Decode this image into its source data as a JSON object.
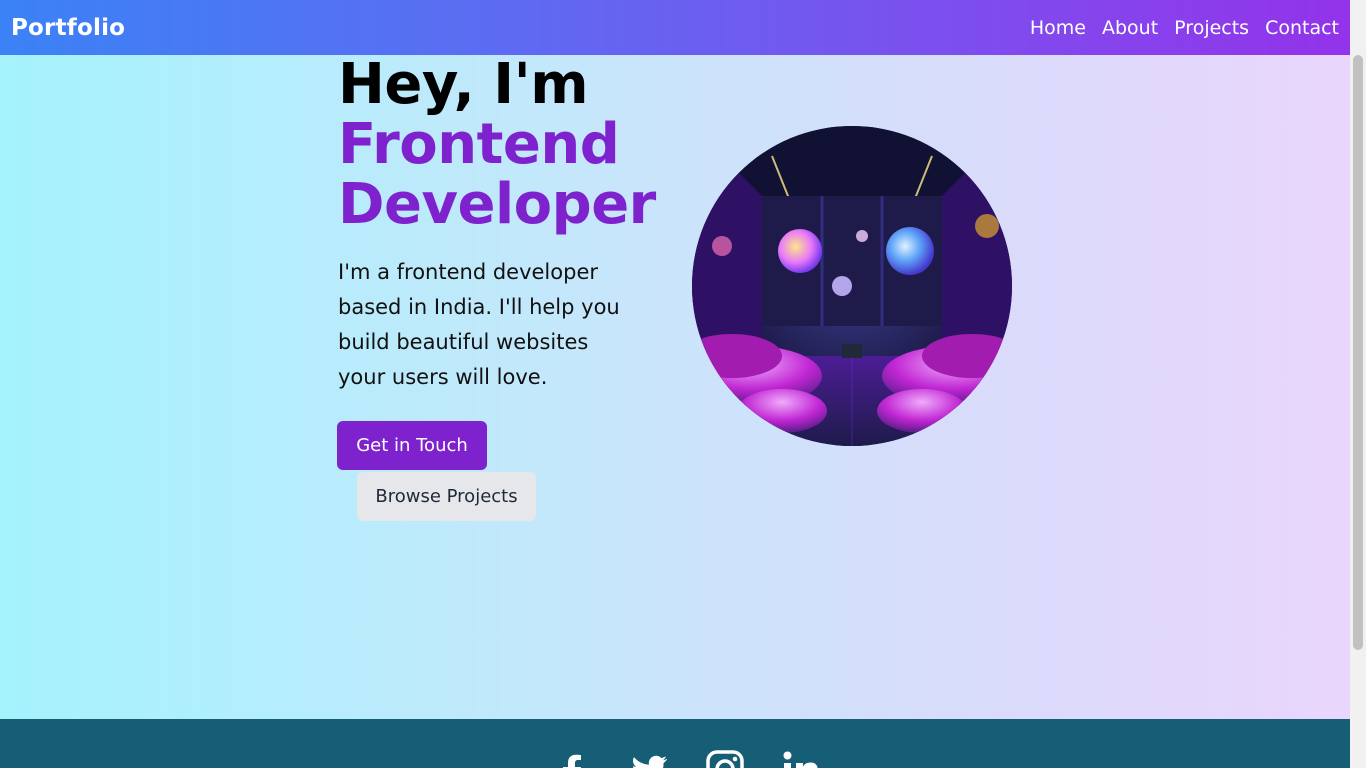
{
  "navbar": {
    "brand": "Portfolio",
    "links": [
      "Home",
      "About",
      "Projects",
      "Contact"
    ]
  },
  "hero": {
    "greeting": "Hey, I'm",
    "role_line1": "Frontend",
    "role_line2": "Developer",
    "description": "I'm a frontend developer based in India. I'll help you build beautiful websites your users will love.",
    "primary_button": "Get in Touch",
    "secondary_button": "Browse Projects",
    "image_icon": "neon-lounge-room-image"
  },
  "footer": {
    "social_icons": [
      "facebook-icon",
      "twitter-icon",
      "instagram-icon",
      "linkedin-icon"
    ]
  },
  "colors": {
    "accent": "#7e22ce",
    "navbar_start": "#3b82f6",
    "navbar_end": "#9333ea",
    "footer": "#155e75"
  }
}
